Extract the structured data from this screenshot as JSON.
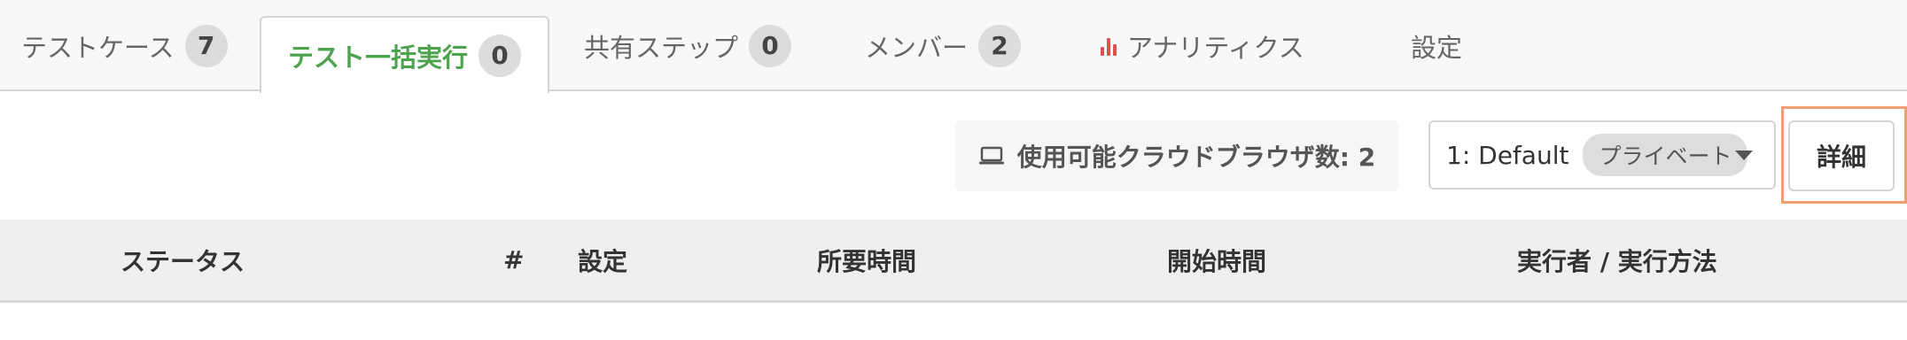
{
  "tabs": [
    {
      "label": "テストケース",
      "count": "7"
    },
    {
      "label": "テスト一括実行",
      "count": "0",
      "active": true
    },
    {
      "label": "共有ステップ",
      "count": "0"
    },
    {
      "label": "メンバー",
      "count": "2"
    },
    {
      "label": "アナリティクス",
      "icon": "bar-chart-icon"
    },
    {
      "label": "設定"
    }
  ],
  "toolbar": {
    "browsers_label": "使用可能クラウドブラウザ数: 2",
    "browsers_icon": "laptop-icon",
    "environment": {
      "value": "1: Default",
      "badge": "プライベート"
    },
    "detail_label": "詳細"
  },
  "table": {
    "columns": [
      "ステータス",
      "#",
      "設定",
      "所要時間",
      "開始時間",
      "実行者 / 実行方法"
    ]
  },
  "colors": {
    "active_tab": "#4ea34e",
    "analytics_icon": "#d9534f",
    "highlight_outline": "#f0a070"
  }
}
